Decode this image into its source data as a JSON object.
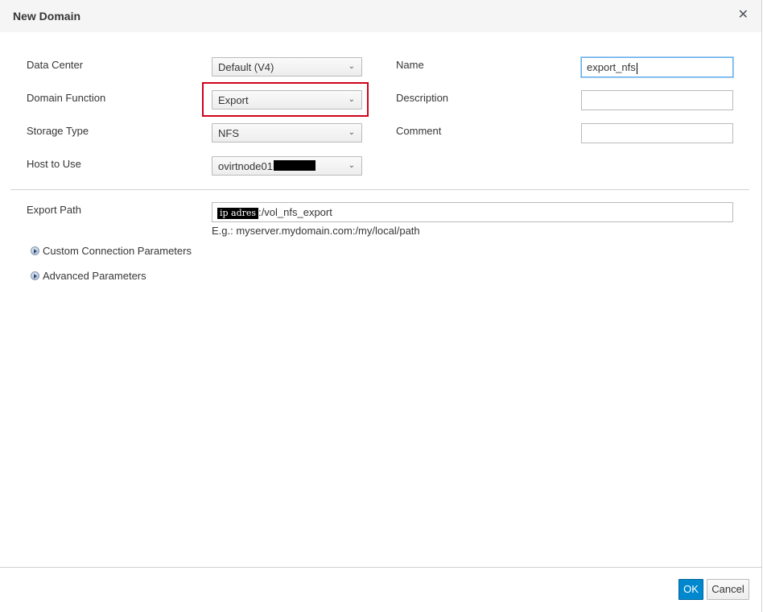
{
  "dialog": {
    "title": "New Domain",
    "close_icon": "close-icon"
  },
  "left_form": {
    "data_center": {
      "label": "Data Center",
      "value": "Default (V4)"
    },
    "domain_function": {
      "label": "Domain Function",
      "value": "Export"
    },
    "storage_type": {
      "label": "Storage Type",
      "value": "NFS"
    },
    "host_to_use": {
      "label": "Host to Use",
      "value": "ovirtnode01"
    }
  },
  "right_form": {
    "name": {
      "label": "Name",
      "value": "export_nfs"
    },
    "description": {
      "label": "Description",
      "value": ""
    },
    "comment": {
      "label": "Comment",
      "value": ""
    }
  },
  "export": {
    "label": "Export Path",
    "redacted_prefix": "ip adres",
    "value_suffix": ":/vol_nfs_export",
    "hint": "E.g.: myserver.mydomain.com:/my/local/path"
  },
  "expanders": {
    "custom_connection": "Custom Connection Parameters",
    "advanced": "Advanced Parameters"
  },
  "footer": {
    "ok_label": "OK",
    "cancel_label": "Cancel"
  },
  "colors": {
    "primary_button": "#0088ce",
    "highlight_box": "#d0021b"
  }
}
